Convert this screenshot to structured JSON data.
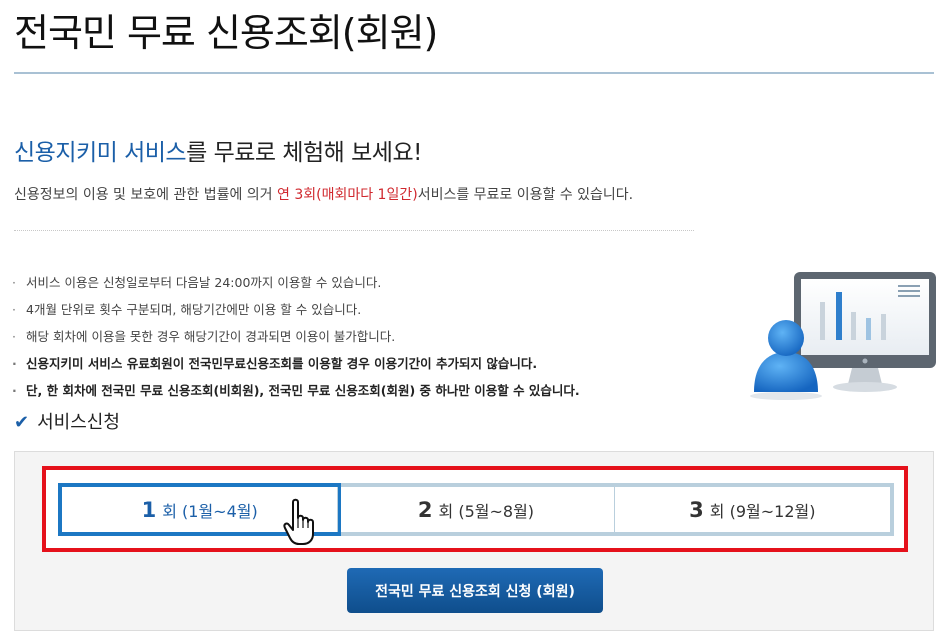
{
  "page": {
    "title": "전국민 무료 신용조회(회원)"
  },
  "intro": {
    "headline_accent": "신용지키미 서비스",
    "headline_rest": "를 무료로 체험해 보세요!",
    "desc_before": "신용정보의 이용 및 보호에 관한 법률에 의거 ",
    "desc_highlight": "연 3회(매회마다 1일간)",
    "desc_after": "서비스를 무료로 이용할 수 있습니다."
  },
  "notes": [
    "서비스 이용은 신청일로부터 다음날 24:00까지 이용할 수 있습니다.",
    "4개월 단위로 횟수 구분되며, 해당기간에만 이용 할 수 있습니다.",
    "해당 회차에 이용을 못한 경우 해당기간이 경과되면 이용이 불가합니다.",
    "신용지키미 서비스 유료회원이 전국민무료신용조회를 이용할 경우 이용기간이 추가되지 않습니다.",
    "단, 한 회차에 전국민 무료 신용조회(비회원), 전국민 무료 신용조회(회원) 중 하나만 이용할 수 있습니다."
  ],
  "note_bullet": "·",
  "service": {
    "section_title": "서비스신청",
    "check_icon": "✔",
    "rounds": [
      {
        "num": "1",
        "label": "회 (1월~4월)",
        "active": true
      },
      {
        "num": "2",
        "label": "회 (5월~8월)",
        "active": false
      },
      {
        "num": "3",
        "label": "회 (9월~12월)",
        "active": false
      }
    ],
    "submit_label": "전국민 무료 신용조회 신청 (회원)"
  },
  "colors": {
    "accent": "#1b5fa8",
    "highlight_red": "#d0282e",
    "frame_red": "#e5111b",
    "active_tab_border": "#1c77c3",
    "button": "#155a9e"
  }
}
